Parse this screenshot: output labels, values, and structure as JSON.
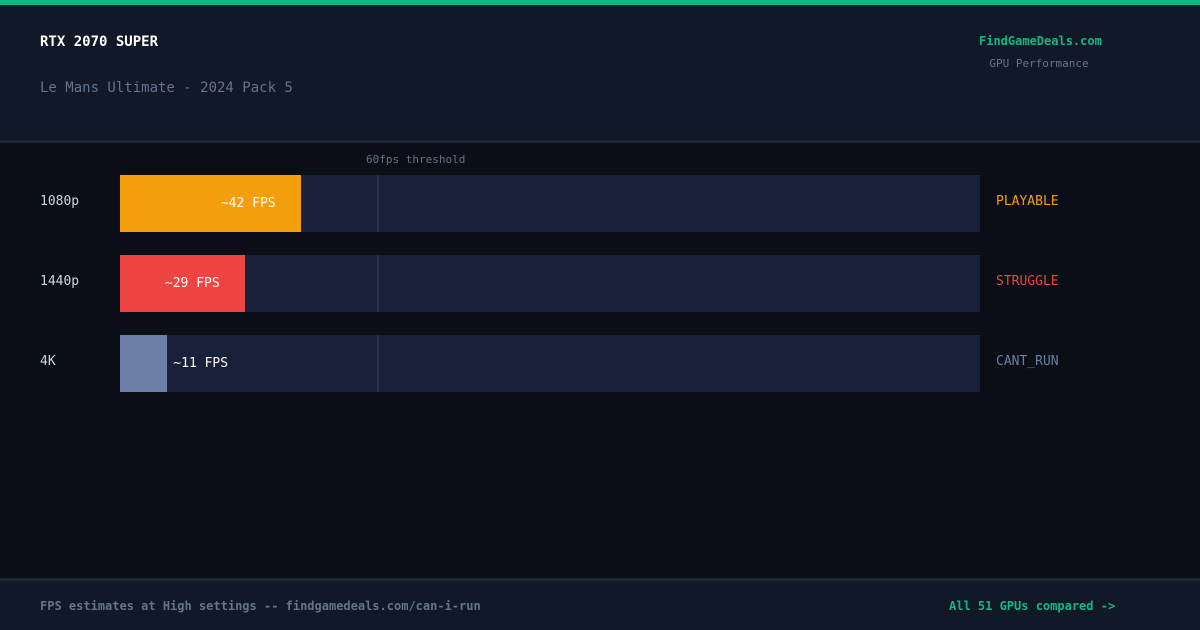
{
  "header": {
    "gpu_name": "RTX 2070 SUPER",
    "game_title": "Le Mans Ultimate - 2024 Pack 5",
    "brand": "FindGameDeals.com",
    "brand_subtitle": "GPU Performance"
  },
  "colors": {
    "accent": "#10b981",
    "playable": "#f59e0b",
    "struggle": "#ef4444",
    "cant_run": "#6b7fa8",
    "track": "#19213a",
    "background": "#0b0e17"
  },
  "chart_data": {
    "type": "bar",
    "orientation": "horizontal",
    "categories": [
      "1080p",
      "1440p",
      "4K"
    ],
    "values": [
      42,
      29,
      11
    ],
    "value_labels": [
      "~42 FPS",
      "~29 FPS",
      "~11 FPS"
    ],
    "statuses": [
      "PLAYABLE",
      "STRUGGLE",
      "CANT_RUN"
    ],
    "status_colors": [
      "#f59e0b",
      "#ef4444",
      "#6b7fa8"
    ],
    "fill_colors": [
      "#f59e0b",
      "#ef4444",
      "#6b7fa8"
    ],
    "xlim": [
      0,
      200
    ],
    "threshold": {
      "value": 60,
      "label": "60fps threshold"
    },
    "grid": false,
    "legend": "none"
  },
  "footer": {
    "note": "FPS estimates at High settings -- findgamedeals.com/can-i-run",
    "link_text": "All 51 GPUs compared ->"
  }
}
